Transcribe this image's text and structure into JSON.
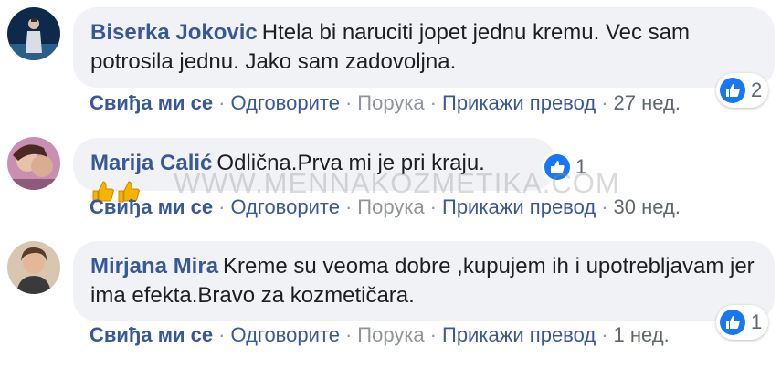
{
  "watermark": "WWW.MENNAKOZMETIKA.COM",
  "comments": [
    {
      "author": "Biserka Jokovic",
      "text": "Htela bi naruciti jopet jednu kremu. Vec sam potrosila jednu. Jako sam zadovoljna.",
      "reactions": "2",
      "actions": {
        "like": "Свиђа ми се",
        "reply": "Одговорите",
        "message": "Порука",
        "translate": "Прикажи превод",
        "time": "27 нед."
      }
    },
    {
      "author": "Marija Calić",
      "text": "Odlična.Prva mi je pri kraju.",
      "reactions": "1",
      "actions": {
        "like": "Свиђа ми се",
        "reply": "Одговорите",
        "message": "Порука",
        "translate": "Прикажи превод",
        "time": "30 нед."
      }
    },
    {
      "author": "Mirjana Mira",
      "text": "Kreme su veoma dobre ,kupujem ih i upotrebljavam jer ima efekta.Bravo za kozmetičara.",
      "reactions": "1",
      "actions": {
        "like": "Свиђа ми се",
        "reply": "Одговорите",
        "message": "Порука",
        "translate": "Прикажи превод",
        "time": "1 нед."
      }
    }
  ],
  "colors": {
    "link": "#385898",
    "bubble": "#f0f2f5",
    "like_badge": "#1877f2"
  },
  "icons": {
    "reaction": "like-thumb-icon",
    "emoji": "thumbs-up-emoji-icon"
  }
}
